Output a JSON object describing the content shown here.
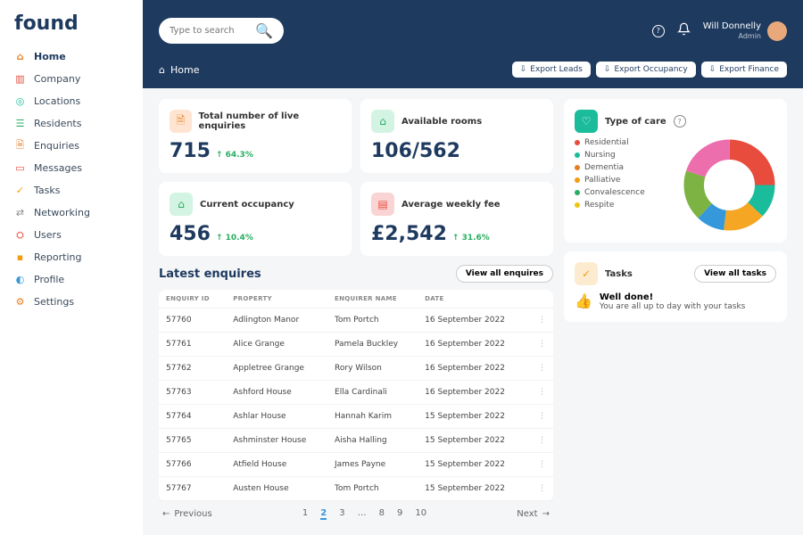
{
  "logo": "found",
  "nav": [
    {
      "label": "Home",
      "icon": "⌂",
      "color": "#e67e22",
      "active": true
    },
    {
      "label": "Company",
      "icon": "▥",
      "color": "#e74c3c"
    },
    {
      "label": "Locations",
      "icon": "◎",
      "color": "#1abc9c"
    },
    {
      "label": "Residents",
      "icon": "☰",
      "color": "#27ae60"
    },
    {
      "label": "Enquiries",
      "icon": "🗎",
      "color": "#e67e22"
    },
    {
      "label": "Messages",
      "icon": "▭",
      "color": "#e74c3c"
    },
    {
      "label": "Tasks",
      "icon": "✓",
      "color": "#f39c12"
    },
    {
      "label": "Networking",
      "icon": "⇄",
      "color": "#888"
    },
    {
      "label": "Users",
      "icon": "⛭",
      "color": "#e74c3c"
    },
    {
      "label": "Reporting",
      "icon": "▪",
      "color": "#f39c12"
    },
    {
      "label": "Profile",
      "icon": "◐",
      "color": "#3498db"
    },
    {
      "label": "Settings",
      "icon": "⚙",
      "color": "#e67e22"
    }
  ],
  "search": {
    "placeholder": "Type to search"
  },
  "topIcons": {
    "help": "?",
    "bell": "🔔"
  },
  "user": {
    "name": "Will Donnelly",
    "role": "Admin"
  },
  "crumb": {
    "icon": "⌂",
    "label": "Home"
  },
  "exports": [
    {
      "label": "Export Leads"
    },
    {
      "label": "Export Occupancy"
    },
    {
      "label": "Export Finance"
    }
  ],
  "metrics": [
    {
      "label": "Total number of live enquiries",
      "value": "715",
      "delta": "↑ 64.3%",
      "icon": "🗎",
      "cls": "ic-orange"
    },
    {
      "label": "Available rooms",
      "value": "106/562",
      "delta": "",
      "icon": "⌂",
      "cls": "ic-green"
    },
    {
      "label": "Current occupancy",
      "value": "456",
      "delta": "↑ 10.4%",
      "icon": "⌂",
      "cls": "ic-green"
    },
    {
      "label": "Average weekly fee",
      "value": "£2,542",
      "delta": "↑ 31.6%",
      "icon": "▤",
      "cls": "ic-red"
    }
  ],
  "care": {
    "title": "Type of care",
    "legend": [
      {
        "name": "Residential",
        "color": "#e74c3c"
      },
      {
        "name": "Nursing",
        "color": "#1abc9c"
      },
      {
        "name": "Dementia",
        "color": "#e67e22"
      },
      {
        "name": "Palliative",
        "color": "#f39c12"
      },
      {
        "name": "Convalescence",
        "color": "#27ae60"
      },
      {
        "name": "Respite",
        "color": "#f1c40f"
      }
    ]
  },
  "tasks": {
    "title": "Tasks",
    "btn": "View all tasks",
    "headline": "Well done!",
    "sub": "You are all up to day with your tasks"
  },
  "enquiries": {
    "title": "Latest enquires",
    "btn": "View all enquires",
    "cols": [
      "ENQUIRY ID",
      "PROPERTY",
      "ENQUIRER NAME",
      "DATE",
      ""
    ],
    "rows": [
      [
        "57760",
        "Adlington Manor",
        "Tom Portch",
        "16 September 2022"
      ],
      [
        "57761",
        "Alice Grange",
        "Pamela Buckley",
        "16 September 2022"
      ],
      [
        "57762",
        "Appletree Grange",
        "Rory Wilson",
        "16 September 2022"
      ],
      [
        "57763",
        "Ashford House",
        "Ella Cardinali",
        "16 September 2022"
      ],
      [
        "57764",
        "Ashlar House",
        "Hannah Karim",
        "15 September 2022"
      ],
      [
        "57765",
        "Ashminster House",
        "Aisha Halling",
        "15 September 2022"
      ],
      [
        "57766",
        "Atfield House",
        "James Payne",
        "15 September 2022"
      ],
      [
        "57767",
        "Austen House",
        "Tom Portch",
        "15 September 2022"
      ]
    ]
  },
  "pager": {
    "prev": "Previous",
    "next": "Next",
    "pages": [
      "1",
      "2",
      "3",
      "…",
      "8",
      "9",
      "10"
    ],
    "active": "2"
  },
  "chart_data": {
    "type": "pie",
    "title": "Type of care",
    "series": [
      {
        "name": "Residential",
        "value": 25,
        "color": "#e74c3c"
      },
      {
        "name": "Nursing",
        "value": 12,
        "color": "#1abc9c"
      },
      {
        "name": "Dementia",
        "value": 15,
        "color": "#f5a623"
      },
      {
        "name": "Palliative",
        "value": 10,
        "color": "#3498db"
      },
      {
        "name": "Convalescence",
        "value": 18,
        "color": "#7cb342"
      },
      {
        "name": "Respite",
        "value": 20,
        "color": "#ec6ead"
      }
    ]
  }
}
